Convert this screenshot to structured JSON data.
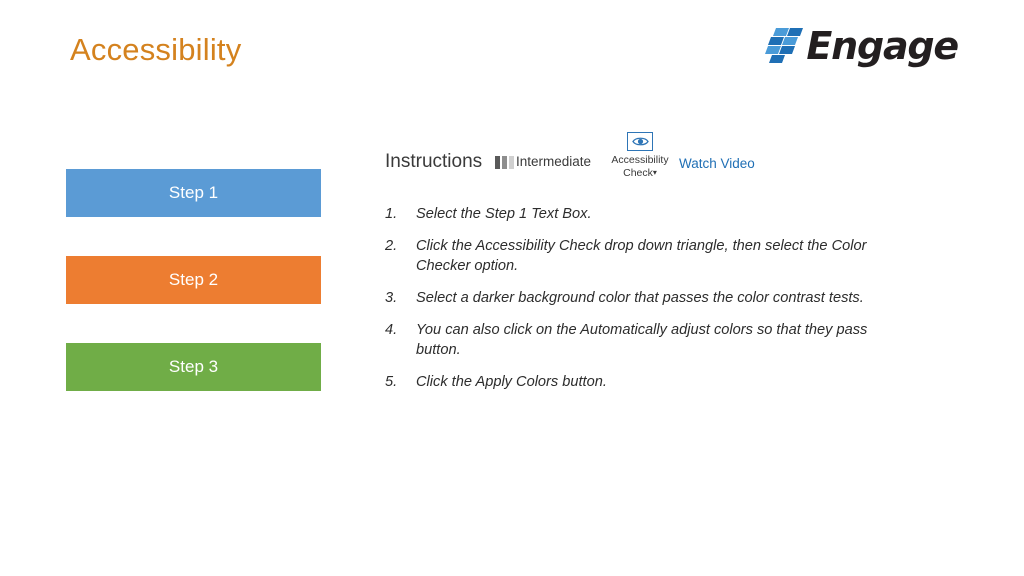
{
  "slide": {
    "title": "Accessibility",
    "title_color": "#D4821E",
    "background": "#ffffff"
  },
  "brand": {
    "name": "Engage",
    "logo_icon": "engage-checker-blocks-icon",
    "colors": {
      "dark_blue": "#1F6FB5",
      "light_blue": "#4A9BD8",
      "wordmark": "#231f20"
    }
  },
  "steps": [
    {
      "label": "Step 1",
      "color": "#5B9BD5"
    },
    {
      "label": "Step 2",
      "color": "#ED7D31"
    },
    {
      "label": "Step 3",
      "color": "#70AD47"
    }
  ],
  "instructions_header": {
    "title": "Instructions",
    "difficulty": {
      "label": "Intermediate",
      "icon": "difficulty-bars-icon",
      "bars_filled": 2,
      "bars_total": 3
    },
    "ribbon_button": {
      "icon": "eye-accessibility-check-icon",
      "line1": "Accessibility",
      "line2": "Check",
      "caret": "▾",
      "accent_color": "#2E75B6"
    },
    "watch_video": {
      "label": "Watch Video",
      "color": "#1F6FB5"
    }
  },
  "instruction_steps": [
    {
      "num": "1.",
      "text": "Select the Step 1 Text Box."
    },
    {
      "num": "2.",
      "text": "Click the Accessibility Check drop down triangle, then select the Color Checker option."
    },
    {
      "num": "3.",
      "text": "Select a darker background color that passes the color contrast tests."
    },
    {
      "num": "4.",
      "text": "You can also click on the Automatically adjust colors so that they pass button."
    },
    {
      "num": "5.",
      "text": "Click the Apply Colors button."
    }
  ]
}
